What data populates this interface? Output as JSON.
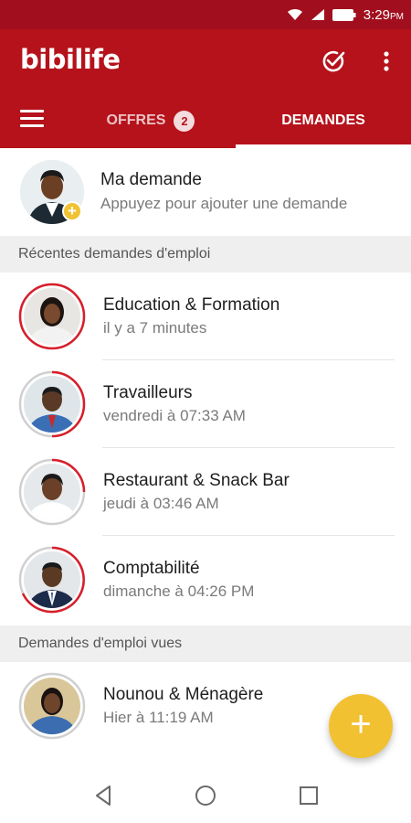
{
  "status_bar": {
    "time": "3:29",
    "ampm": "PM"
  },
  "app_bar": {
    "title": "bibilife"
  },
  "tabs": [
    {
      "label": "OFFRES",
      "badge": "2"
    },
    {
      "label": "DEMANDES"
    }
  ],
  "my_request": {
    "title": "Ma demande",
    "subtitle": "Appuyez pour ajouter une demande"
  },
  "sections": {
    "recent": "Récentes demandes d'emploi",
    "viewed": "Demandes d'emploi vues"
  },
  "recent_items": [
    {
      "title": "Education & Formation",
      "time": "il y a 7 minutes"
    },
    {
      "title": "Travailleurs",
      "time": "vendredi à 07:33 AM"
    },
    {
      "title": "Restaurant & Snack Bar",
      "time": "jeudi à 03:46 AM"
    },
    {
      "title": "Comptabilité",
      "time": "dimanche à 04:26 PM"
    }
  ],
  "viewed_items": [
    {
      "title": "Nounou & Ménagère",
      "time": "Hier à 11:19 AM"
    }
  ],
  "colors": {
    "primary": "#b5121b",
    "status_bar": "#a10f1e",
    "accent": "#f2c131"
  }
}
